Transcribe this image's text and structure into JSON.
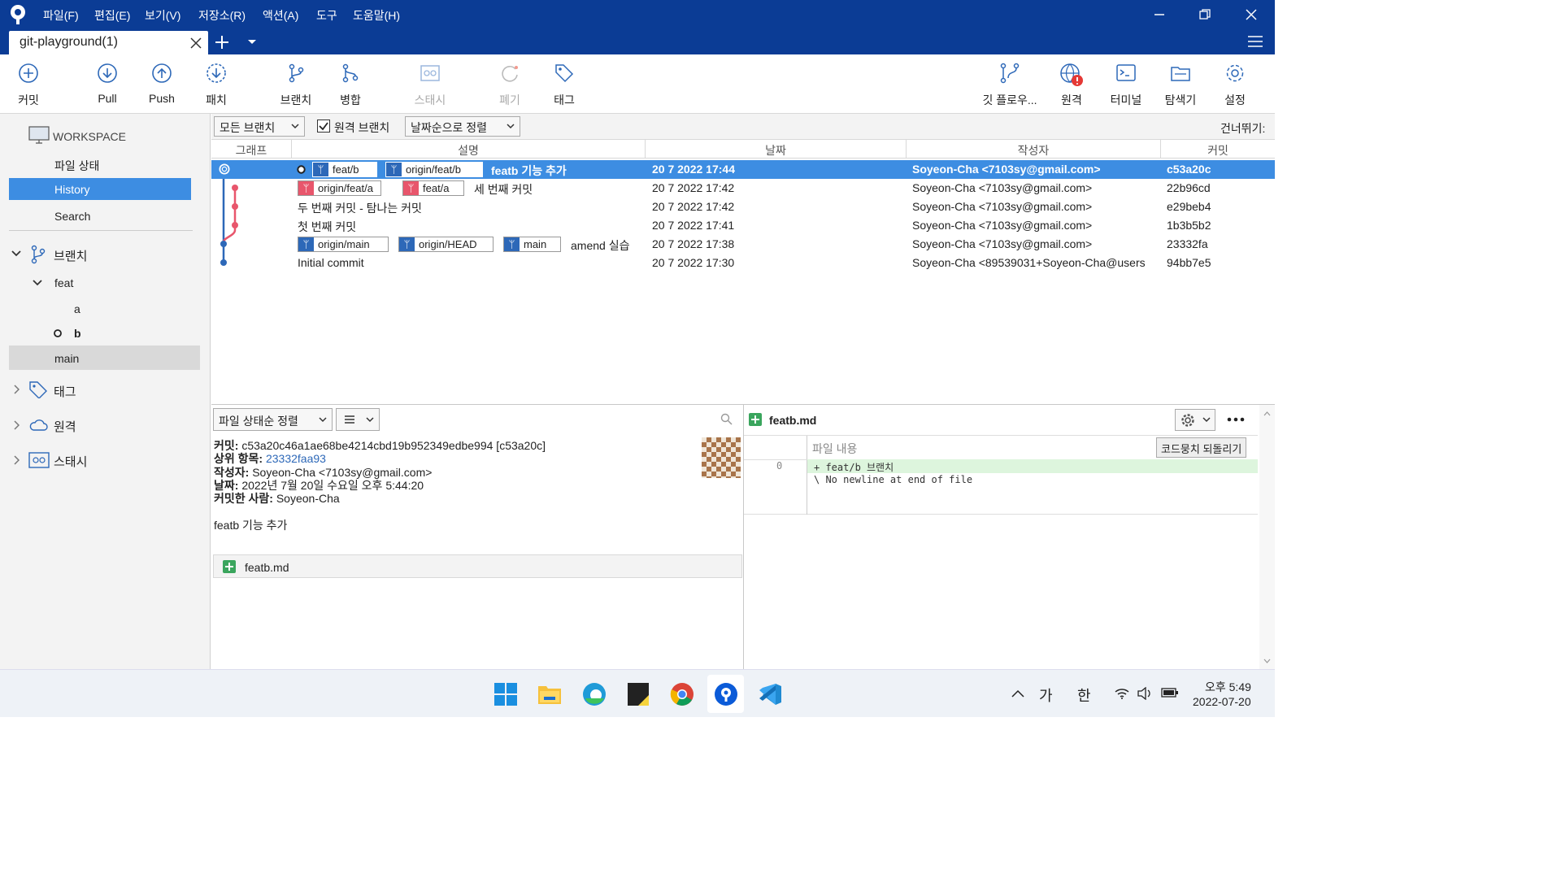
{
  "window": {
    "menu": [
      "파일(F)",
      "편집(E)",
      "보기(V)",
      "저장소(R)",
      "액션(A)",
      "도구",
      "도움말(H)"
    ],
    "tab_title": "git-playground(1)"
  },
  "toolbar": {
    "commit": "커밋",
    "pull": "Pull",
    "push": "Push",
    "patch": "패치",
    "branch": "브랜치",
    "merge": "병합",
    "stash": "스태시",
    "discard": "폐기",
    "tag": "태그",
    "gitflow": "깃 플로우...",
    "remote": "원격",
    "terminal": "터미널",
    "explorer": "탐색기",
    "settings": "설정"
  },
  "sidebar": {
    "workspace": "WORKSPACE",
    "file_status": "파일 상태",
    "history": "History",
    "search": "Search",
    "branches": "브랜치",
    "feat": "feat",
    "branch_a": "a",
    "branch_b": "b",
    "main": "main",
    "tags": "태그",
    "remotes": "원격",
    "stashes": "스태시"
  },
  "filter": {
    "branches": "모든 브랜치",
    "remote_branches": "원격 브랜치",
    "remote_checked": true,
    "sort": "날짜순으로 정렬",
    "jump": "건너뛰기:"
  },
  "columns": {
    "graph": "그래프",
    "desc": "설명",
    "date": "날짜",
    "author": "작성자",
    "commit": "커밋"
  },
  "commits": [
    {
      "tags": [
        "feat/b",
        "origin/feat/b"
      ],
      "message": "featb 기능 추가",
      "date": "20 7 2022 17:44",
      "author": "Soyeon-Cha <7103sy@gmail.com>",
      "hash": "c53a20c"
    },
    {
      "tags": [
        "origin/feat/a",
        "feat/a"
      ],
      "message": "세 번째 커밋",
      "date": "20 7 2022 17:42",
      "author": "Soyeon-Cha <7103sy@gmail.com>",
      "hash": "22b96cd"
    },
    {
      "tags": [],
      "message": "두 번째 커밋 - 탐나는 커밋",
      "date": "20 7 2022 17:42",
      "author": "Soyeon-Cha <7103sy@gmail.com>",
      "hash": "e29beb4"
    },
    {
      "tags": [],
      "message": "첫 번째 커밋",
      "date": "20 7 2022 17:41",
      "author": "Soyeon-Cha <7103sy@gmail.com>",
      "hash": "1b3b5b2"
    },
    {
      "tags": [
        "origin/main",
        "origin/HEAD",
        "main"
      ],
      "message": "amend 실습",
      "date": "20 7 2022 17:38",
      "author": "Soyeon-Cha <7103sy@gmail.com>",
      "hash": "23332fa"
    },
    {
      "tags": [],
      "message": "Initial commit",
      "date": "20 7 2022 17:30",
      "author": "Soyeon-Cha <89539031+Soyeon-Cha@users",
      "hash": "94bb7e5"
    }
  ],
  "details": {
    "sort": "파일 상태순 정렬",
    "commit_label": "커밋:",
    "commit_value": "c53a20c46a1ae68be4214cbd19b952349edbe994 [c53a20c]",
    "parent_label": "상위 항목:",
    "parent_value": "23332faa93",
    "author_label": "작성자:",
    "author_value": "Soyeon-Cha <7103sy@gmail.com>",
    "date_label": "날짜:",
    "date_value": "2022년 7월 20일 수요일 오후 5:44:20",
    "committer_label": "커밋한 사람:",
    "committer_value": "Soyeon-Cha",
    "message": "featb 기능 추가",
    "file": "featb.md"
  },
  "diff": {
    "filename": "featb.md",
    "hunk_header": "파일 내용",
    "revert_button": "코드뭉치 되돌리기",
    "line_no": "0",
    "lines": [
      "+ feat/b 브랜치",
      "\\ No newline at end of file"
    ]
  },
  "taskbar": {
    "ime1": "가",
    "ime2": "한",
    "time": "오후 5:49",
    "date": "2022-07-20"
  },
  "colors": {
    "titlebar": "#0b3c95",
    "selected": "#3d8de2",
    "accent": "#2d68b8",
    "branch_red": "#e8566c"
  }
}
